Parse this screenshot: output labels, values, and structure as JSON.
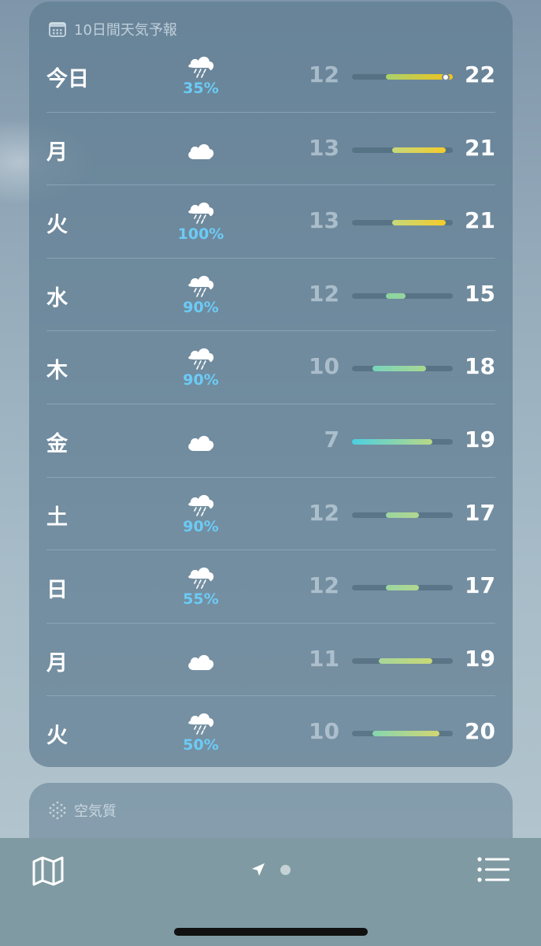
{
  "forecast": {
    "title": "10日間天気予報",
    "days": [
      {
        "label": "今日",
        "icon": "rain-cloud-icon",
        "precip": "35%",
        "low": "12",
        "high": "22",
        "range_from": 12,
        "range_to": 22,
        "current": 21,
        "c1": "#a8d26c",
        "c2": "#f4c21a"
      },
      {
        "label": "月",
        "icon": "cloud-icon",
        "precip": "",
        "low": "13",
        "high": "21",
        "range_from": 13,
        "range_to": 21,
        "c1": "#c6d87a",
        "c2": "#f4cc2a"
      },
      {
        "label": "火",
        "icon": "rain-cloud-icon",
        "precip": "100%",
        "low": "13",
        "high": "21",
        "range_from": 13,
        "range_to": 21,
        "c1": "#c6d87a",
        "c2": "#f4cc2a"
      },
      {
        "label": "水",
        "icon": "rain-cloud-icon",
        "precip": "90%",
        "low": "12",
        "high": "15",
        "range_from": 12,
        "range_to": 15,
        "c1": "#8ad3a4",
        "c2": "#94d69a"
      },
      {
        "label": "木",
        "icon": "rain-cloud-icon",
        "precip": "90%",
        "low": "10",
        "high": "18",
        "range_from": 10,
        "range_to": 18,
        "c1": "#78d4bc",
        "c2": "#a8d890"
      },
      {
        "label": "金",
        "icon": "cloud-icon",
        "precip": "",
        "low": "7",
        "high": "19",
        "range_from": 7,
        "range_to": 19,
        "c1": "#4cd0e0",
        "c2": "#b8d886"
      },
      {
        "label": "土",
        "icon": "rain-cloud-icon",
        "precip": "90%",
        "low": "12",
        "high": "17",
        "range_from": 12,
        "range_to": 17,
        "c1": "#9ad6a0",
        "c2": "#b2d690"
      },
      {
        "label": "日",
        "icon": "rain-cloud-icon",
        "precip": "55%",
        "low": "12",
        "high": "17",
        "range_from": 12,
        "range_to": 17,
        "c1": "#9ad6a0",
        "c2": "#b2d690"
      },
      {
        "label": "月",
        "icon": "cloud-icon",
        "precip": "",
        "low": "11",
        "high": "19",
        "range_from": 11,
        "range_to": 19,
        "c1": "#a6d69a",
        "c2": "#c8d876"
      },
      {
        "label": "火",
        "icon": "rain-cloud-icon",
        "precip": "50%",
        "low": "10",
        "high": "20",
        "range_from": 10,
        "range_to": 20,
        "c1": "#84d6b0",
        "c2": "#d2d672"
      }
    ],
    "scale_min": 7,
    "scale_max": 22
  },
  "air_quality": {
    "title": "空気質",
    "icon": "air-quality-dots-icon"
  },
  "toolbar": {
    "map_icon": "map-icon",
    "location_icon": "location-arrow-icon",
    "page_indicator": "page-dot",
    "list_icon": "list-icon"
  },
  "colors": {
    "precip_text": "#6ccbf6",
    "card_bg": "#607d92",
    "toolbar_bg": "#7f9aa2"
  }
}
